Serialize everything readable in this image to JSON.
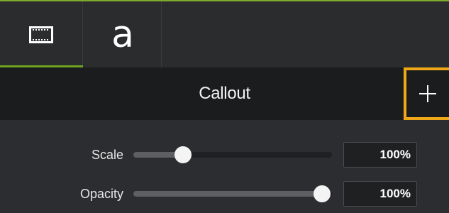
{
  "tabs": [
    {
      "name": "visual-properties",
      "icon": "film-strip-icon",
      "active": true
    },
    {
      "name": "annotation-properties",
      "glyph": "a",
      "active": false
    }
  ],
  "section": {
    "title": "Callout",
    "add_button": {
      "icon": "plus-icon",
      "highlight_color": "#f0a818"
    }
  },
  "properties": [
    {
      "label": "Scale",
      "value_text": "100%",
      "slider_position": 0.25
    },
    {
      "label": "Opacity",
      "value_text": "100%",
      "slider_position": 0.95
    }
  ],
  "colors": {
    "accent_green": "#6fa31f",
    "highlight_orange": "#f0a818",
    "panel_bg": "#2c2d30",
    "header_bg": "#1b1c1e"
  }
}
